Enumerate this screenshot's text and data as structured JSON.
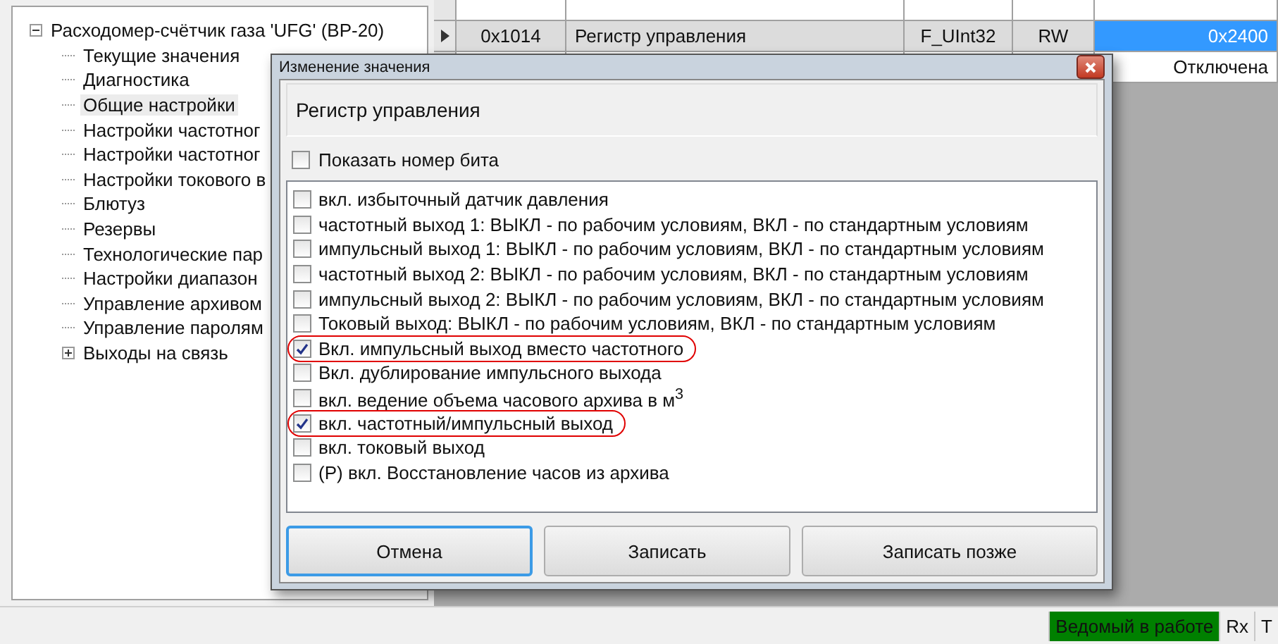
{
  "tree": {
    "label": "Расходомер-счётчик газа 'UFG' (BP-20)",
    "expanded": true,
    "children": [
      {
        "label": "Текущие значения",
        "selected": false
      },
      {
        "label": "Диагностика",
        "selected": false
      },
      {
        "label": "Общие настройки",
        "selected": true
      },
      {
        "label": "Настройки частотног",
        "selected": false
      },
      {
        "label": "Настройки частотног",
        "selected": false
      },
      {
        "label": "Настройки токового в",
        "selected": false
      },
      {
        "label": "Блютуз",
        "selected": false
      },
      {
        "label": "Резервы",
        "selected": false
      },
      {
        "label": "Технологические пар",
        "selected": false
      },
      {
        "label": "Настройки диапазон",
        "selected": false
      },
      {
        "label": "Управление архивом",
        "selected": false
      },
      {
        "label": "Управление паролям",
        "selected": false
      },
      {
        "label": "Выходы на связь",
        "selected": false,
        "expanded": false
      }
    ]
  },
  "grid": {
    "rows": [
      {
        "current": false,
        "address": "",
        "name": "",
        "type": "",
        "access": "",
        "value": ""
      },
      {
        "current": true,
        "address": "0x1014",
        "name": "Регистр управления",
        "type": "F_UInt32",
        "access": "RW",
        "value": "0x2400"
      },
      {
        "current": false,
        "address": "",
        "name": "",
        "type": "",
        "access": "",
        "value": "Отключена"
      }
    ]
  },
  "dialog": {
    "title": "Изменение значения",
    "register_name": "Регистр управления",
    "show_bits": {
      "label": "Показать номер бита",
      "checked": false
    },
    "bits": [
      {
        "label": "вкл. избыточный датчик давления",
        "checked": false,
        "highlighted": false
      },
      {
        "label": "частотный выход 1: ВЫКЛ - по рабочим условиям, ВКЛ - по стандартным условиям",
        "checked": false,
        "highlighted": false
      },
      {
        "label": "импульсный выход 1: ВЫКЛ - по рабочим условиям, ВКЛ - по стандартным условиям",
        "checked": false,
        "highlighted": false
      },
      {
        "label": "частотный выход 2: ВЫКЛ - по рабочим условиям, ВКЛ - по стандартным условиям",
        "checked": false,
        "highlighted": false
      },
      {
        "label": "импульсный выход 2: ВЫКЛ - по рабочим условиям, ВКЛ - по стандартным условиям",
        "checked": false,
        "highlighted": false
      },
      {
        "label": "Токовый выход: ВЫКЛ - по рабочим условиям, ВКЛ - по стандартным условиям",
        "checked": false,
        "highlighted": false
      },
      {
        "label": "Вкл. импульсный выход вместо частотного",
        "checked": true,
        "highlighted": true
      },
      {
        "label": "Вкл. дублирование импульсного выхода",
        "checked": false,
        "highlighted": false
      },
      {
        "label": "вкл. ведение объема часового архива в м$^{3}$",
        "checked": false,
        "highlighted": false
      },
      {
        "label": "вкл. частотный/импульсный выход",
        "checked": true,
        "highlighted": true
      },
      {
        "label": "вкл. токовый выход",
        "checked": false,
        "highlighted": false
      },
      {
        "label": "(P) вкл. Восстановление часов из архива",
        "checked": false,
        "highlighted": false
      }
    ],
    "buttons": [
      {
        "label": "Отмена",
        "focused": true
      },
      {
        "label": "Записать",
        "focused": false
      },
      {
        "label": "Записать позже",
        "focused": false
      }
    ]
  },
  "status_bar": {
    "items": [
      {
        "label": "Ведомый в работе",
        "color": "#008000"
      },
      {
        "label": "Rx",
        "color": "#f0f0f0"
      },
      {
        "label": "T",
        "color": "#f0f0f0"
      }
    ]
  }
}
